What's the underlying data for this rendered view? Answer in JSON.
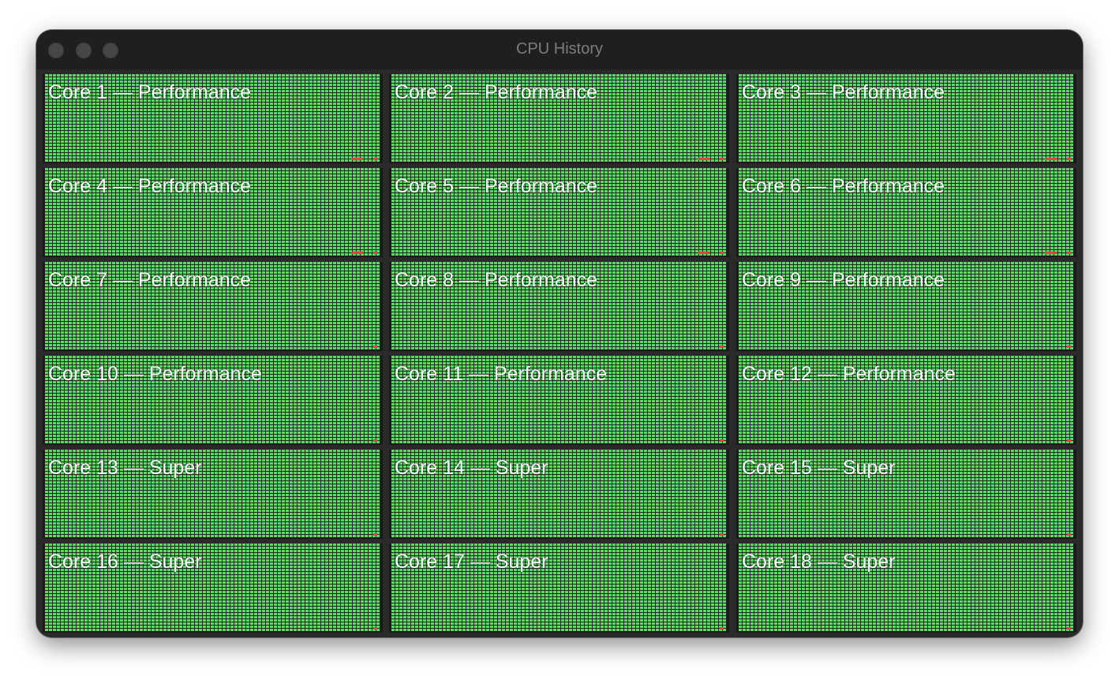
{
  "window": {
    "title": "CPU History"
  },
  "colors": {
    "idle": "#5ed865",
    "grid": "#1c2a1d",
    "load": "#e0443c",
    "background": "#2a2a2a"
  },
  "cores": [
    {
      "label": "Core 1 — Performance",
      "type": "Performance"
    },
    {
      "label": "Core 2 — Performance",
      "type": "Performance"
    },
    {
      "label": "Core 3 — Performance",
      "type": "Performance"
    },
    {
      "label": "Core 4 — Performance",
      "type": "Performance"
    },
    {
      "label": "Core 5 — Performance",
      "type": "Performance"
    },
    {
      "label": "Core 6 — Performance",
      "type": "Performance"
    },
    {
      "label": "Core 7 — Performance",
      "type": "Performance"
    },
    {
      "label": "Core 8 — Performance",
      "type": "Performance"
    },
    {
      "label": "Core 9 — Performance",
      "type": "Performance"
    },
    {
      "label": "Core 10 — Performance",
      "type": "Performance"
    },
    {
      "label": "Core 11 — Performance",
      "type": "Performance"
    },
    {
      "label": "Core 12 — Performance",
      "type": "Performance"
    },
    {
      "label": "Core 13 — Super",
      "type": "Super"
    },
    {
      "label": "Core 14 — Super",
      "type": "Super"
    },
    {
      "label": "Core 15 — Super",
      "type": "Super"
    },
    {
      "label": "Core 16 — Super",
      "type": "Super"
    },
    {
      "label": "Core 17 — Super",
      "type": "Super"
    },
    {
      "label": "Core 18 — Super",
      "type": "Super"
    }
  ]
}
